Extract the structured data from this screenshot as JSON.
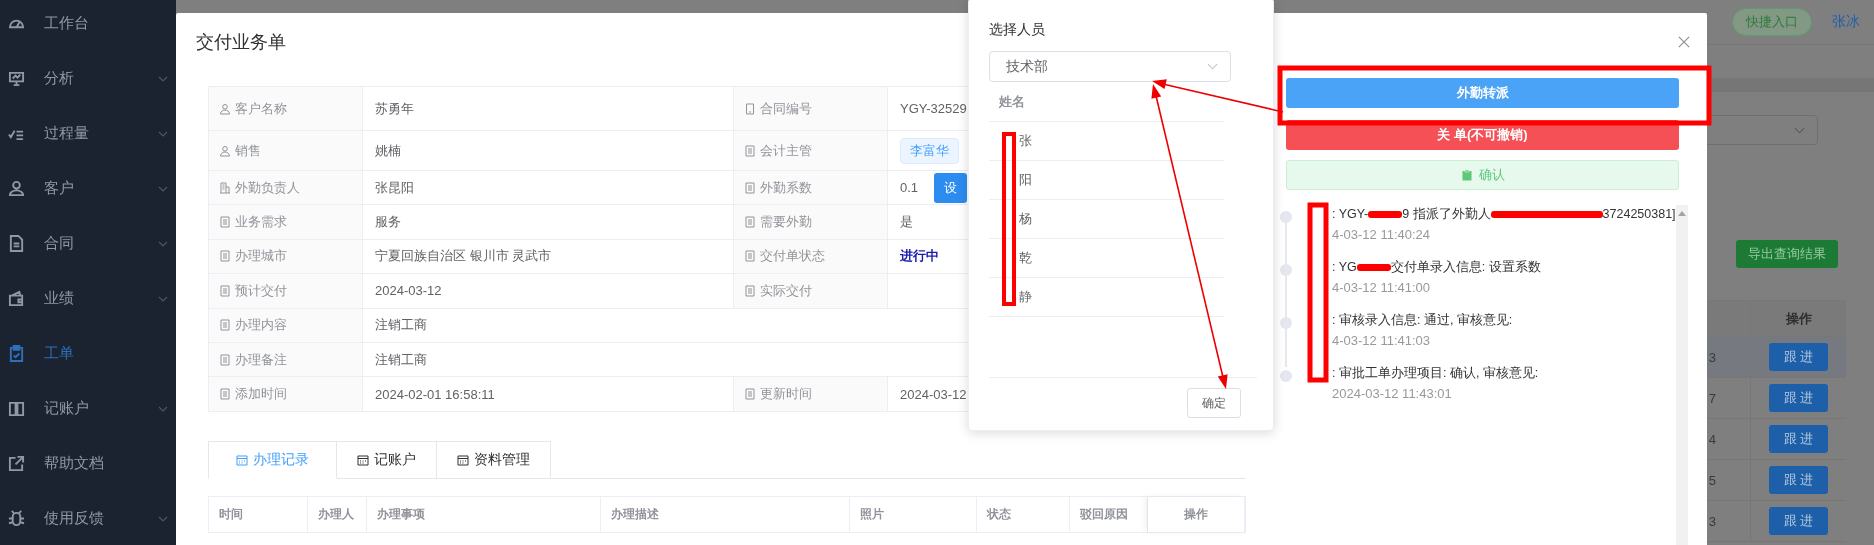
{
  "sidebar": {
    "items": [
      {
        "label": "工作台",
        "selected": false,
        "expandable": false
      },
      {
        "label": "分析",
        "selected": false,
        "expandable": true
      },
      {
        "label": "过程量",
        "selected": false,
        "expandable": true
      },
      {
        "label": "客户",
        "selected": false,
        "expandable": true
      },
      {
        "label": "合同",
        "selected": false,
        "expandable": true
      },
      {
        "label": "业绩",
        "selected": false,
        "expandable": true
      },
      {
        "label": "工单",
        "selected": true,
        "expandable": false
      },
      {
        "label": "记账户",
        "selected": false,
        "expandable": true
      },
      {
        "label": "帮助文档",
        "selected": false,
        "expandable": false
      },
      {
        "label": "使用反馈",
        "selected": false,
        "expandable": true
      }
    ]
  },
  "background": {
    "quick_entry": "快捷入口",
    "user": "张冰",
    "export_button": "导出查询结果",
    "table": {
      "columns": [
        "操作"
      ],
      "rows": [
        {
          "column_1": "3",
          "action": "跟 进"
        },
        {
          "column_1": "7",
          "action": "跟 进"
        },
        {
          "column_1": "4",
          "action": "跟 进"
        },
        {
          "column_1": "5",
          "action": "跟 进"
        },
        {
          "column_1": "3",
          "action": "跟 进"
        }
      ]
    }
  },
  "modal": {
    "title": "交付业务单",
    "details": [
      {
        "cells": [
          {
            "label": "客户名称",
            "value": "苏勇年",
            "kind": "text"
          },
          {
            "label": "合同编号",
            "value": "YGY-32529",
            "kind": "text"
          }
        ]
      },
      {
        "cells": [
          {
            "label": "销售",
            "value": "姚楠",
            "kind": "text"
          },
          {
            "label": "会计主管",
            "value": "李富华",
            "kind": "tag"
          }
        ]
      },
      {
        "cells": [
          {
            "label": "外勤负责人",
            "value": "张昆阳",
            "kind": "text"
          },
          {
            "label": "外勤系数",
            "value": "0.1",
            "button": "设",
            "kind": "button"
          }
        ]
      },
      {
        "cells": [
          {
            "label": "业务需求",
            "value": "服务",
            "kind": "text"
          },
          {
            "label": "需要外勤",
            "value": "是",
            "kind": "text"
          }
        ]
      },
      {
        "cells": [
          {
            "label": "办理城市",
            "value": "宁夏回族自治区 银川市 灵武市",
            "kind": "text"
          },
          {
            "label": "交付单状态",
            "value": "进行中",
            "kind": "status"
          }
        ]
      },
      {
        "cells": [
          {
            "label": "预计交付",
            "value": "2024-03-12",
            "kind": "text"
          },
          {
            "label": "实际交付",
            "kind": "text"
          }
        ]
      },
      {
        "cells": [
          {
            "label": "办理内容",
            "value": "注销工商",
            "kind": "text"
          }
        ]
      },
      {
        "cells": [
          {
            "label": "办理备注",
            "value": "注销工商",
            "kind": "text"
          }
        ]
      },
      {
        "cells": [
          {
            "label": "添加时间",
            "value": "2024-02-01 16:58:11",
            "kind": "text"
          },
          {
            "label": "更新时间",
            "value": "2024-03-12",
            "kind": "text"
          }
        ]
      }
    ],
    "tabs": [
      {
        "label": "办理记录",
        "selected": true
      },
      {
        "label": "记账户",
        "selected": false
      },
      {
        "label": "资料管理",
        "selected": false
      }
    ],
    "records_table": {
      "columns": [
        "时间",
        "办理人",
        "办理事项",
        "办理描述",
        "照片",
        "状态",
        "驳回原因",
        "操作"
      ]
    },
    "actions": [
      {
        "label": "外勤转派",
        "kind": "primary"
      },
      {
        "label": "关 单(不可撤销)",
        "kind": "danger"
      },
      {
        "label": "确认",
        "kind": "success"
      }
    ],
    "timeline": [
      {
        "segments": [
          {
            "kind": "text",
            "text": ": YGY-"
          },
          {
            "kind": "short_redaction"
          },
          {
            "kind": "text",
            "text": "9 指派了外勤人"
          },
          {
            "kind": "long_redaction"
          },
          {
            "kind": "text",
            "text": "3724250381]"
          }
        ],
        "time": "4-03-12 11:40:24"
      },
      {
        "segments": [
          {
            "kind": "text",
            "text": ": YG"
          },
          {
            "kind": "short_redaction"
          },
          {
            "kind": "text",
            "text": "交付单录入信息: 设置系数"
          }
        ],
        "time": "4-03-12 11:41:00"
      },
      {
        "segments": [
          {
            "kind": "text",
            "text": ": 审核录入信息: 通过, 审核意见:"
          }
        ],
        "time": "4-03-12 11:41:03"
      },
      {
        "segments": [
          {
            "kind": "text",
            "text": ": 审批工单办理项目: 确认, 审核意见:"
          }
        ],
        "time": "2024-03-12 11:43:01"
      }
    ]
  },
  "popover": {
    "title": "选择人员",
    "department": "技术部",
    "column": "姓名",
    "names": [
      "张",
      "阳",
      "杨",
      "乾",
      "静"
    ],
    "confirm": "确定"
  }
}
